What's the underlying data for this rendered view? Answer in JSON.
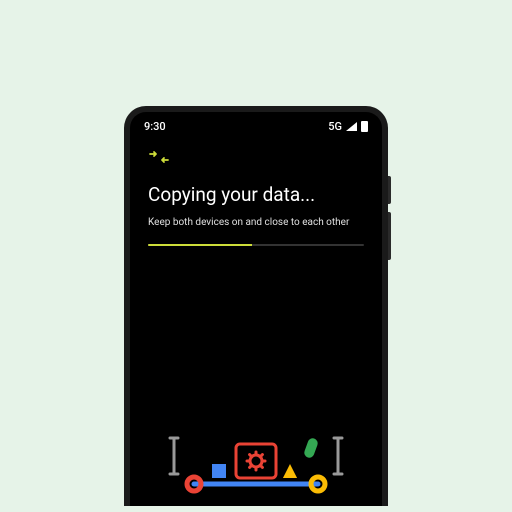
{
  "status": {
    "time": "9:30",
    "network": "5G"
  },
  "screen": {
    "title": "Copying your data...",
    "subtitle": "Keep both devices on and close to each other",
    "progress_percent": 48
  },
  "colors": {
    "accent": "#cddc39",
    "bg": "#000000",
    "frame_bg": "#e6f3e8"
  }
}
